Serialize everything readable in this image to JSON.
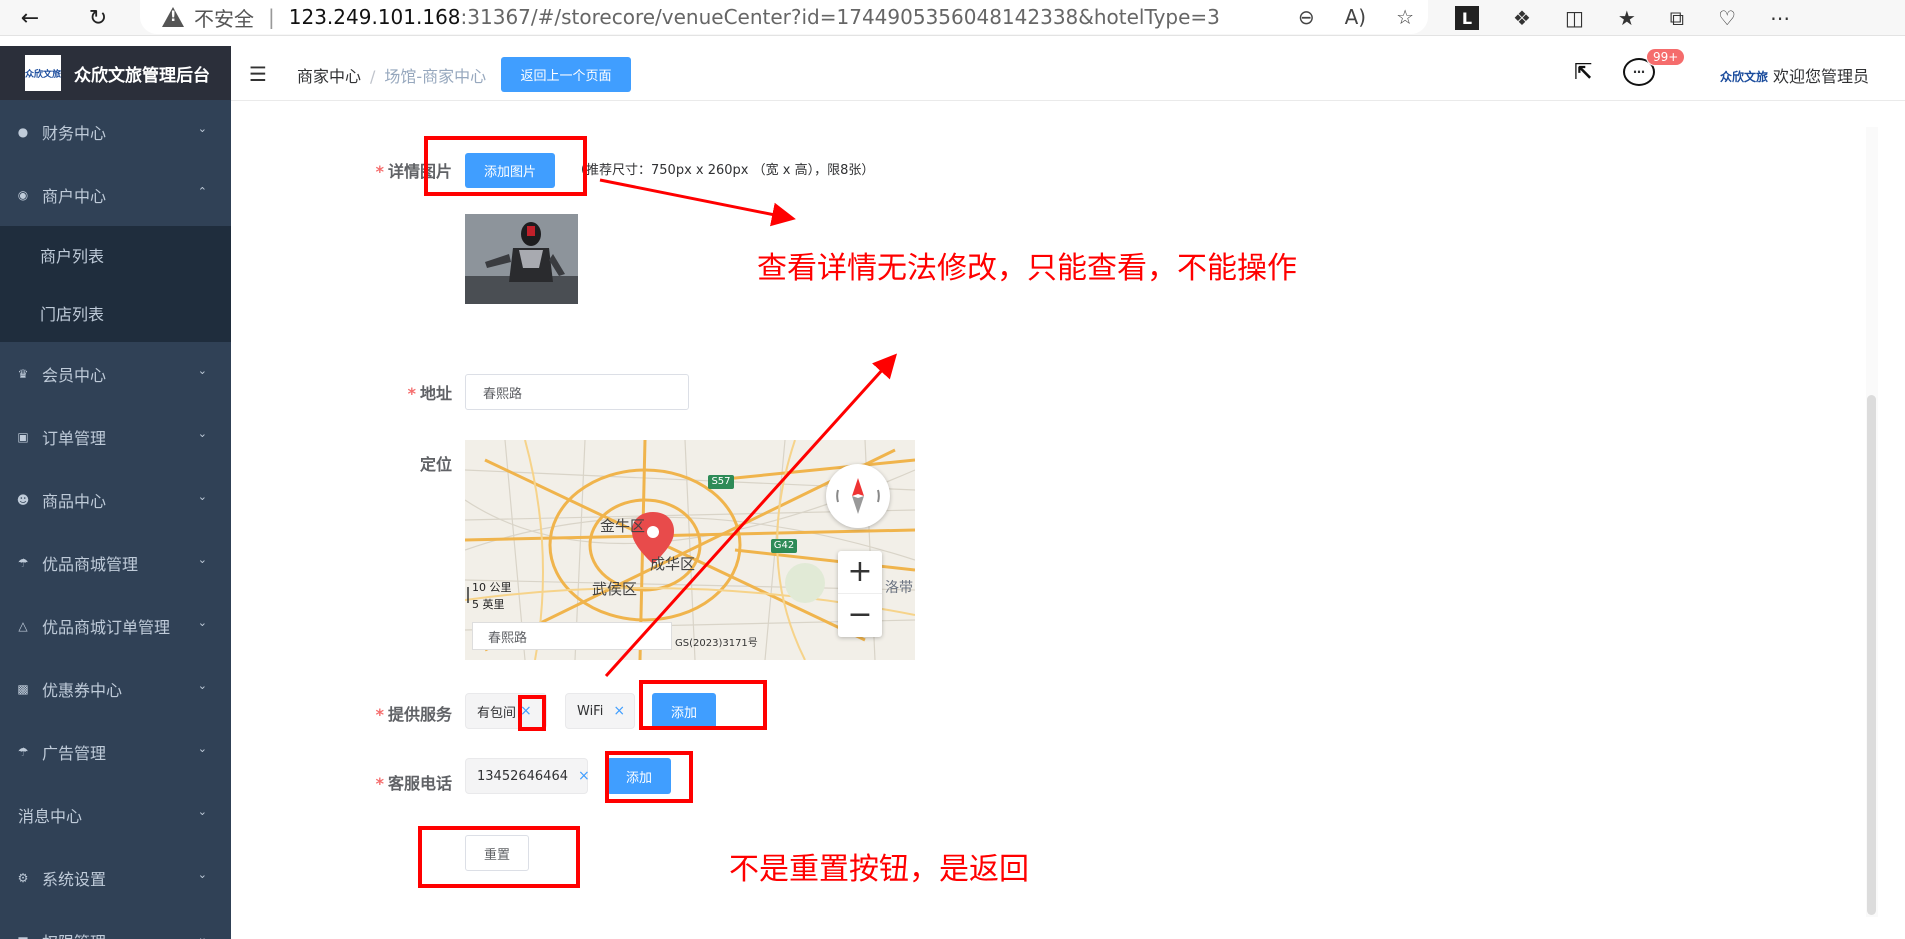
{
  "browser": {
    "insecure_label": "不安全",
    "url_host": "123.249.101.168",
    "url_rest": ":31367/#/storecore/venueCenter?id=1744905356048142338&hotelType=3",
    "ext_letter": "L"
  },
  "sidebar": {
    "logo_text": "众欣文旅",
    "title": "众欣文旅管理后台",
    "items": [
      {
        "label": "财务中心"
      },
      {
        "label": "商户中心"
      },
      {
        "label": "商户列表"
      },
      {
        "label": "门店列表"
      },
      {
        "label": "会员中心"
      },
      {
        "label": "订单管理"
      },
      {
        "label": "商品中心"
      },
      {
        "label": "优品商城管理"
      },
      {
        "label": "优品商城订单管理"
      },
      {
        "label": "优惠券中心"
      },
      {
        "label": "广告管理"
      },
      {
        "label": "消息中心"
      },
      {
        "label": "系统设置"
      },
      {
        "label": "权限管理"
      }
    ]
  },
  "header": {
    "breadcrumb_1": "商家中心",
    "breadcrumb_sep": "/",
    "breadcrumb_2": "场馆-商家中心",
    "back_button": "返回上一个页面",
    "badge": "99+",
    "mini_logo": "众欣文旅",
    "welcome": "欢迎您管理员"
  },
  "form": {
    "detail_images_label": "详情图片",
    "add_image_button": "添加图片",
    "image_hint": "（推荐尺寸：750px x 260px （宽 x 高），限8张）",
    "address_label": "地址",
    "address_value": "春熙路",
    "location_label": "定位",
    "map": {
      "district_1": "金牛区",
      "district_2": "成华区",
      "district_3": "武侯区",
      "district_4": "洛带",
      "road_1": "S57",
      "road_2": "G42",
      "scale_km": "10 公里",
      "scale_mi": "5 英里",
      "search_value": "春熙路",
      "copyright": "GS(2023)3171号",
      "zoom_in": "+",
      "zoom_out": "−"
    },
    "services_label": "提供服务",
    "services": [
      "有包间",
      "WiFi"
    ],
    "service_add_button": "添加",
    "phone_label": "客服电话",
    "phones": [
      "13452646464"
    ],
    "phone_add_button": "添加",
    "reset_button": "重置"
  },
  "annotations": {
    "note_1": "查看详情无法修改，只能查看，不能操作",
    "note_2": "不是重置按钮，是返回"
  },
  "colors": {
    "primary": "#409eff",
    "sidebar_bg": "#304156",
    "annotation": "#ff0000"
  }
}
